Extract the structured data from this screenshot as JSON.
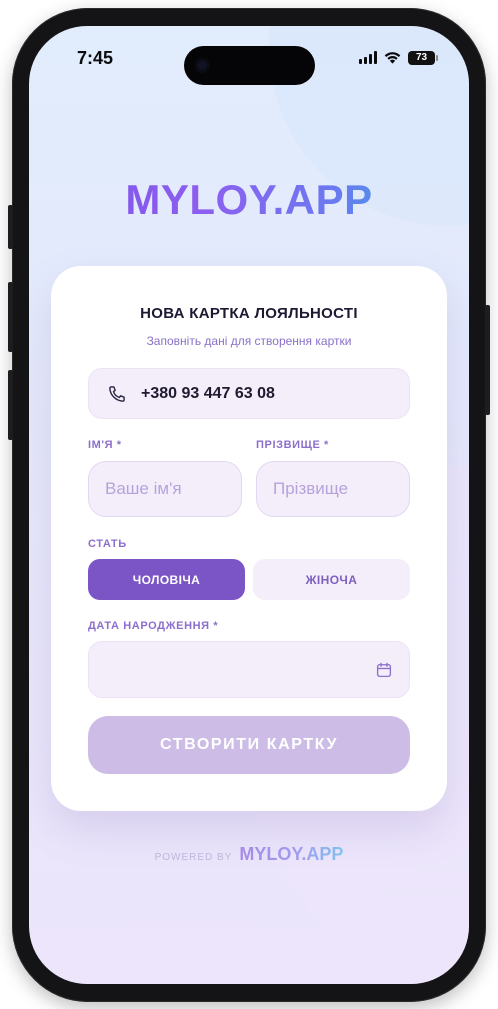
{
  "status_bar": {
    "time": "7:45",
    "battery": "73"
  },
  "brand": {
    "logo": "MYLOY.APP"
  },
  "form": {
    "title": "НОВА КАРТКА ЛОЯЛЬНОСТІ",
    "subtitle": "Заповніть дані для створення картки",
    "phone_value": "+380 93 447 63 08",
    "phone_icon": "phone-icon",
    "first_name": {
      "label": "ІМ'Я *",
      "placeholder": "Ваше ім'я",
      "value": ""
    },
    "last_name": {
      "label": "ПРІЗВИЩЕ *",
      "placeholder": "Прізвище",
      "value": ""
    },
    "gender": {
      "label": "СТАТЬ",
      "options": [
        "ЧОЛОВІЧА",
        "ЖІНОЧА"
      ],
      "selected": "ЧОЛОВІЧА"
    },
    "birth_date": {
      "label": "ДАТА НАРОДЖЕННЯ *",
      "value": "",
      "icon": "calendar-icon"
    },
    "submit_label": "СТВОРИТИ КАРТКУ"
  },
  "footer": {
    "powered_by": "POWERED BY",
    "logo": "MYLOY.APP"
  },
  "colors": {
    "accent": "#7b55c5",
    "accent_light": "#cdbde6",
    "field_bg": "#f3eefa",
    "label": "#8c6fcc"
  }
}
